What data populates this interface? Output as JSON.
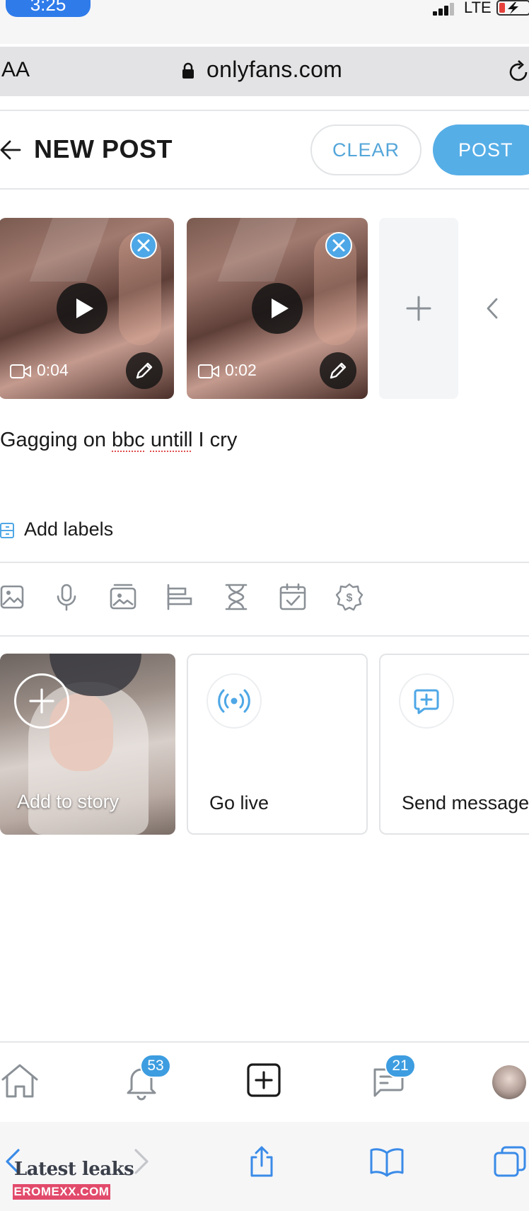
{
  "status_bar": {
    "time": "3:25",
    "network": "LTE"
  },
  "browser": {
    "text_size_label": "AA",
    "url": "onlyfans.com"
  },
  "header": {
    "title": "NEW POST",
    "clear_label": "CLEAR",
    "post_label": "POST"
  },
  "media": [
    {
      "duration": "0:04"
    },
    {
      "duration": "0:02"
    }
  ],
  "caption": {
    "part1": "Gagging on ",
    "word2": "bbc",
    "space": " ",
    "word3": "untill",
    "part4": " I cry"
  },
  "labels": {
    "text": "Add labels"
  },
  "cards": {
    "story": "Add to story",
    "live": "Go live",
    "message": "Send message"
  },
  "bottom_nav": {
    "notifications_count": "53",
    "messages_count": "21"
  },
  "watermark": {
    "line1": "Latest leaks",
    "line2": "EROMEXX.COM"
  },
  "colors": {
    "accent": "#56aee7",
    "clear_text": "#54a6d9",
    "badge": "#3d9de0",
    "time_pill": "#2f7bea",
    "watermark_bg": "#e24a6b"
  },
  "icons": [
    "signal-icon",
    "battery-icon",
    "lock-icon",
    "reload-icon",
    "back-arrow-icon",
    "remove-icon",
    "play-icon",
    "video-camera-icon",
    "edit-pencil-icon",
    "plus-icon",
    "chevron-left-icon",
    "labels-icon",
    "image-icon",
    "microphone-icon",
    "gallery-icon",
    "poll-icon",
    "hourglass-icon",
    "calendar-check-icon",
    "price-tag-icon",
    "broadcast-icon",
    "message-plus-icon",
    "home-icon",
    "bell-icon",
    "add-post-icon",
    "chat-icon",
    "share-icon",
    "bookmarks-icon",
    "tabs-icon"
  ]
}
